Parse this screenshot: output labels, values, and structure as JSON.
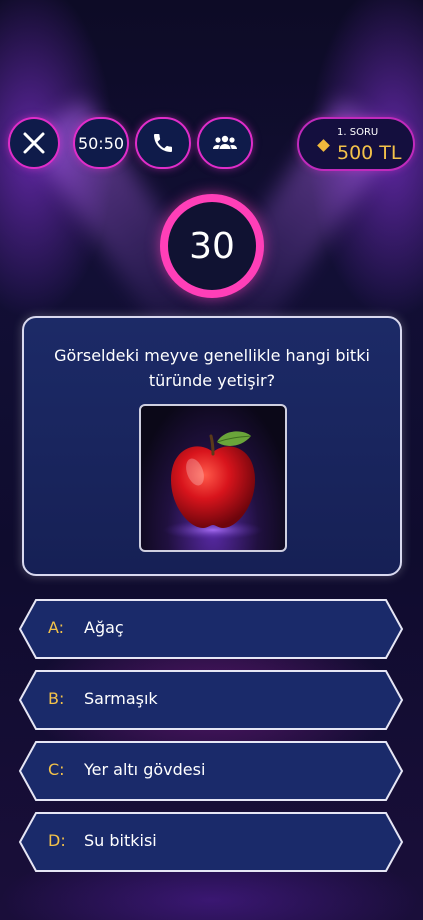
{
  "lifelines": {
    "fifty_label": "50:50"
  },
  "prize": {
    "question_label": "1. SORU",
    "amount": "500 TL"
  },
  "timer": {
    "seconds": "30"
  },
  "question": {
    "text": "Görseldeki meyve genellikle hangi bitki türünde yetişir?"
  },
  "answers": [
    {
      "letter": "A:",
      "text": "Ağaç"
    },
    {
      "letter": "B:",
      "text": "Sarmaşık"
    },
    {
      "letter": "C:",
      "text": "Yer altı gövdesi"
    },
    {
      "letter": "D:",
      "text": "Su bitkisi"
    }
  ],
  "colors": {
    "accent_pink": "#ff3fb8",
    "gold": "#f3c24a",
    "card_blue": "#1c2a67"
  }
}
